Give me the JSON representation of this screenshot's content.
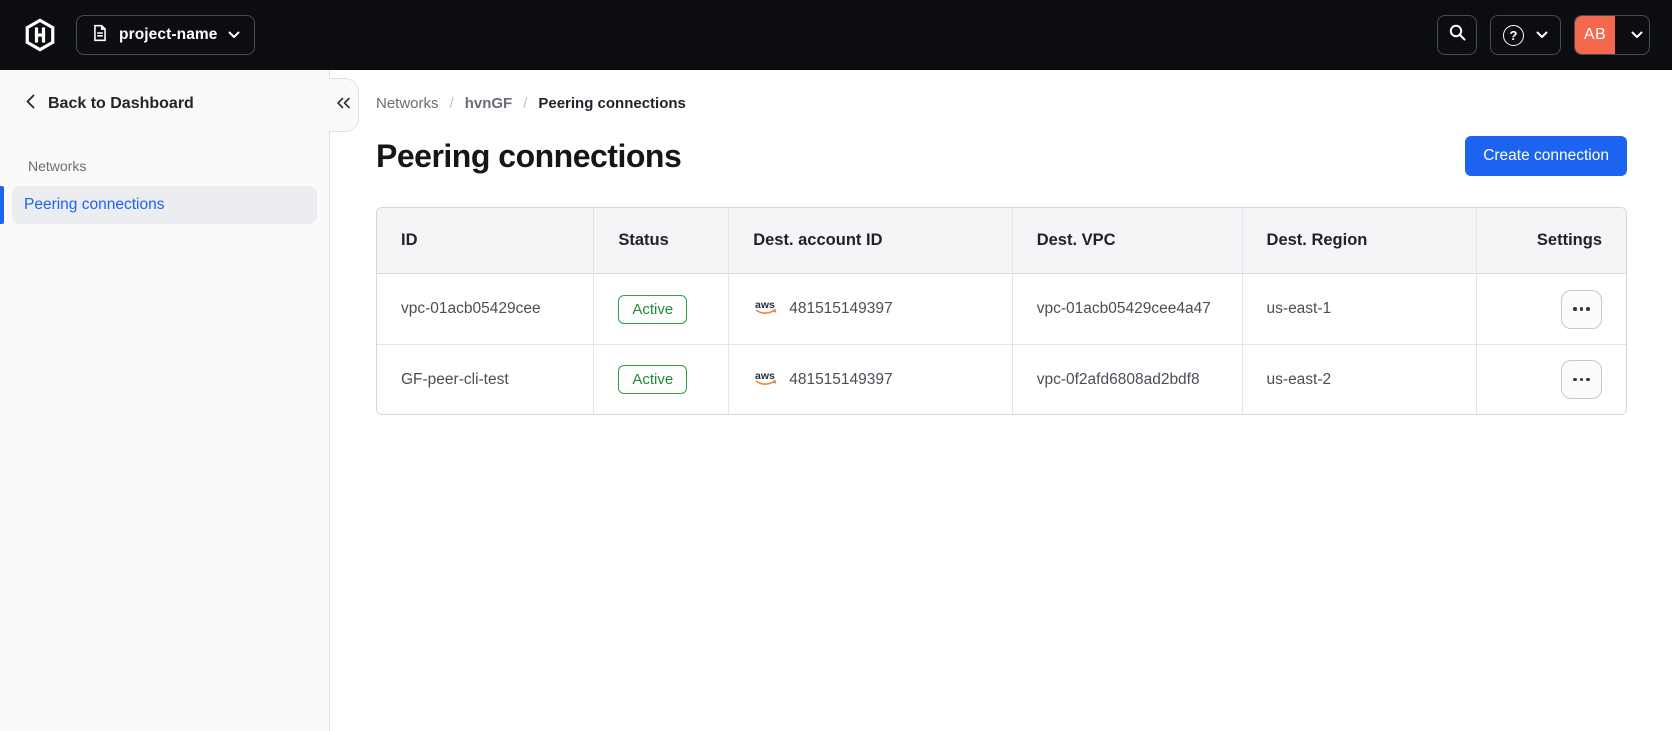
{
  "topbar": {
    "project_switcher_label": "project-name",
    "avatar_initials": "AB",
    "help_glyph": "?"
  },
  "sidebar": {
    "back_label": "Back to Dashboard",
    "section_label": "Networks",
    "active_item_label": "Peering connections"
  },
  "breadcrumb": {
    "separator": "/",
    "items": [
      "Networks",
      "hvnGF",
      "Peering connections"
    ]
  },
  "page": {
    "title": "Peering connections",
    "create_button_label": "Create connection"
  },
  "table": {
    "columns": [
      "ID",
      "Status",
      "Dest. account ID",
      "Dest. VPC",
      "Dest. Region",
      "Settings"
    ],
    "rows": [
      {
        "id": "vpc-01acb05429cee",
        "status": "Active",
        "dest_account_id": "481515149397",
        "dest_vpc": "vpc-01acb05429cee4a47",
        "dest_region": "us-east-1"
      },
      {
        "id": "GF-peer-cli-test",
        "status": "Active",
        "dest_account_id": "481515149397",
        "dest_vpc": "vpc-0f2afd6808ad2bdf8",
        "dest_region": "us-east-2"
      }
    ]
  },
  "colors": {
    "topbar_bg": "#0c0d10",
    "accent_blue": "#1c63f2",
    "avatar_coral": "#f4694e",
    "success_green": "#2e9e4b",
    "aws_orange": "#e8873b"
  }
}
